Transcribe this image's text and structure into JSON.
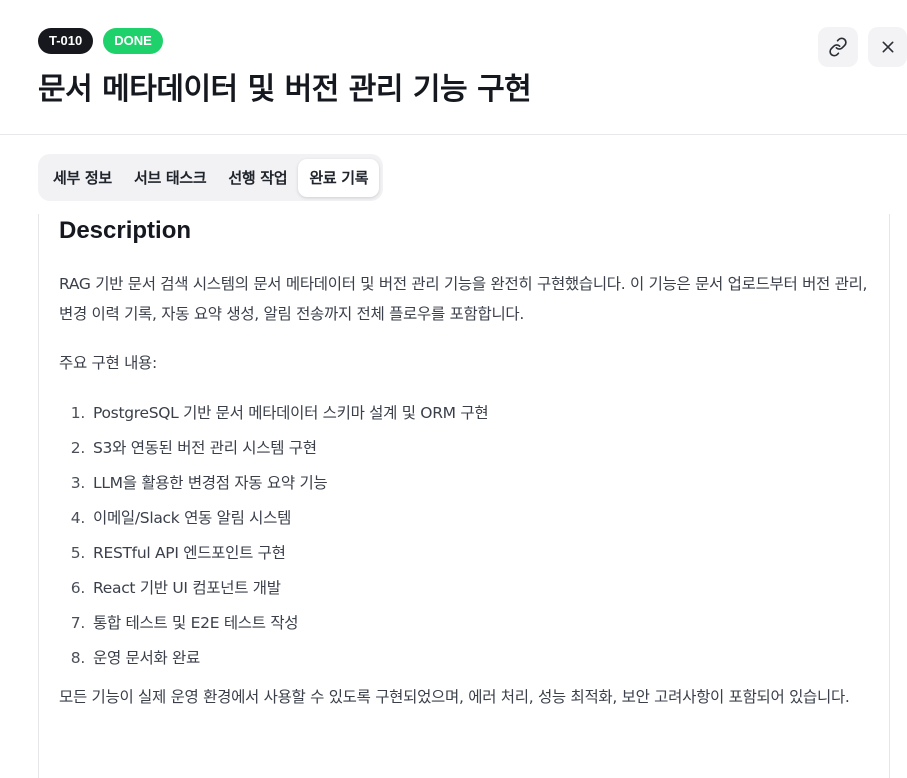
{
  "header": {
    "task_id": "T-010",
    "status": "DONE",
    "title": "문서 메타데이터 및 버전 관리 기능 구현"
  },
  "tabs": [
    {
      "label": "세부 정보"
    },
    {
      "label": "서브 태스크"
    },
    {
      "label": "선행 작업"
    },
    {
      "label": "완료 기록",
      "active": true
    }
  ],
  "content": {
    "heading": "Description",
    "intro": "RAG 기반 문서 검색 시스템의 문서 메타데이터 및 버전 관리 기능을 완전히 구현했습니다. 이 기능은 문서 업로드부터 버전 관리, 변경 이력 기록, 자동 요약 생성, 알림 전송까지 전체 플로우를 포함합니다.",
    "list_intro": "주요 구현 내용:",
    "items": [
      {
        "num": "1.",
        "text": "PostgreSQL 기반 문서 메타데이터 스키마 설계 및 ORM 구현"
      },
      {
        "num": "2.",
        "text": "S3와 연동된 버전 관리 시스템 구현"
      },
      {
        "num": "3.",
        "text": "LLM을 활용한 변경점 자동 요약 기능"
      },
      {
        "num": "4.",
        "text": "이메일/Slack 연동 알림 시스템"
      },
      {
        "num": "5.",
        "text": "RESTful API 엔드포인트 구현"
      },
      {
        "num": "6.",
        "text": "React 기반 UI 컴포넌트 개발"
      },
      {
        "num": "7.",
        "text": "통합 테스트 및 E2E 테스트 작성"
      },
      {
        "num": "8.",
        "text": "운영 문서화 완료"
      }
    ],
    "closing": "모든 기능이 실제 운영 환경에서 사용할 수 있도록 구현되었으며, 에러 처리, 성능 최적화, 보안 고려사항이 포함되어 있습니다."
  },
  "icons": {
    "link": "link-icon",
    "close": "close-icon"
  },
  "colors": {
    "id_badge": "#16181d",
    "status_badge": "#1fd16b"
  }
}
